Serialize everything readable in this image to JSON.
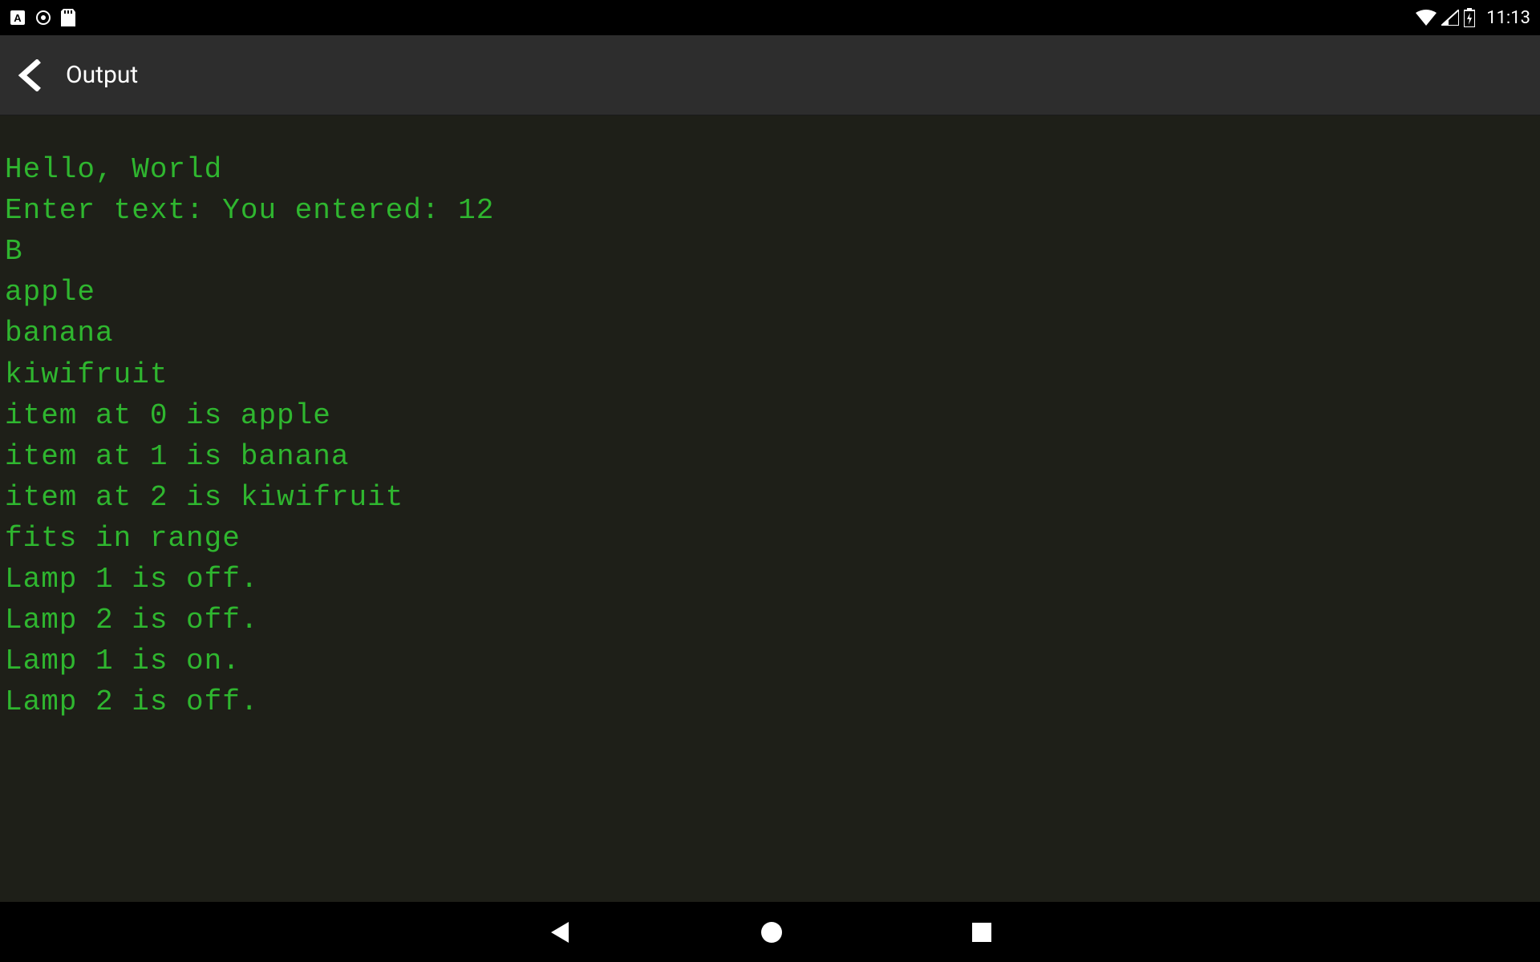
{
  "status_bar": {
    "time": "11:13",
    "icons_left": [
      "keyboard-icon",
      "circle-icon",
      "sd-card-icon"
    ],
    "icons_right": [
      "wifi-icon",
      "signal-icon",
      "battery-charging-icon"
    ]
  },
  "action_bar": {
    "title": "Output"
  },
  "console": {
    "lines": [
      "Hello, World",
      "Enter text: You entered: 12",
      "B",
      "apple",
      "banana",
      "kiwifruit",
      "item at 0 is apple",
      "item at 1 is banana",
      "item at 2 is kiwifruit",
      "fits in range",
      "Lamp 1 is off.",
      "Lamp 2 is off.",
      "Lamp 1 is on.",
      "Lamp 2 is off."
    ]
  },
  "colors": {
    "console_bg": "#1e1f18",
    "console_text": "#2fb62f",
    "action_bar_bg": "#2d2d2d"
  }
}
